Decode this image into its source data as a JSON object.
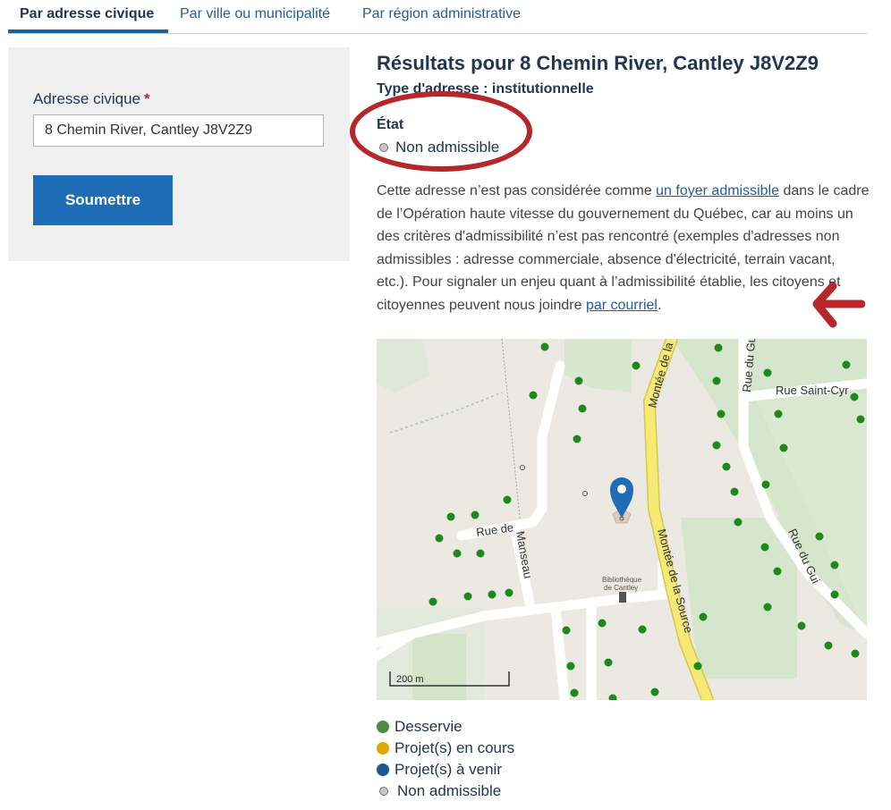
{
  "tabs": [
    {
      "label": "Par adresse civique",
      "active": true
    },
    {
      "label": "Par ville ou municipalité",
      "active": false
    },
    {
      "label": "Par région administrative",
      "active": false
    }
  ],
  "form": {
    "label": "Adresse civique",
    "required_mark": "*",
    "address_value": "8 Chemin River, Cantley J8V2Z9",
    "submit_label": "Soumettre"
  },
  "results": {
    "title": "Résultats pour 8 Chemin River, Cantley J8V2Z9",
    "address_type": "Type d'adresse : institutionnelle",
    "state_label": "État",
    "state_value": "Non admissible",
    "para_text1": "Cette adresse n’est pas considérée comme ",
    "para_link1": "un foyer admissible",
    "para_text2": " dans le cadre de l’Opération haute vitesse du gouvernement du Québec, car au moins un des critères d'admissibilité n’est pas rencontré (exemples d'adresses non admissibles : adresse commerciale, absence d'électricité, terrain vacant, etc.). Pour signaler un enjeu quant à l’admissibilité établie, les citoyens et citoyennes peuvent nous joindre ",
    "para_link2": "par courriel",
    "para_text3": "."
  },
  "map": {
    "streets": {
      "monte_de_la_top": "Montée de la",
      "monte_de_la_source": "Montée de la Source",
      "rue_du_gui_top": "Rue du Gui",
      "rue_saint_cyr": "Rue Saint-Cyr",
      "rue_de": "Rue de",
      "manseau": "Manseau",
      "rue_du_gui": "Rue du Gui"
    },
    "poi_line1": "Bibliothèque",
    "poi_line2": "de Cantley",
    "scale_label": "200 m",
    "colors": {
      "served": "#1b8a1b",
      "pin": "#1f6db6",
      "road_yellow": "#f6ea76"
    }
  },
  "legend": [
    {
      "label": "Desservie",
      "color": "#4d8a3c"
    },
    {
      "label": "Projet(s) en cours",
      "color": "#e0a800"
    },
    {
      "label": "Projet(s) à venir",
      "color": "#1a5691"
    },
    {
      "label": "Non admissible",
      "color": "#c4c4c4"
    }
  ]
}
